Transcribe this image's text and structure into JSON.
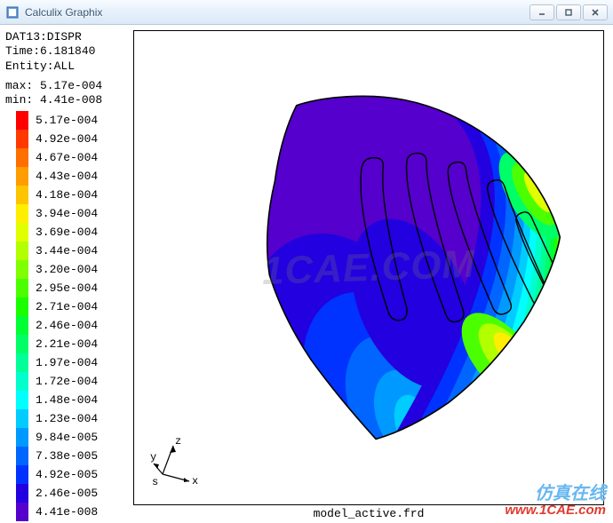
{
  "window": {
    "title": "Calculix Graphix"
  },
  "info": {
    "dataset": "DAT13:DISPR",
    "time_label": "Time:6.181840",
    "entity": "Entity:ALL"
  },
  "range": {
    "max_label": "max: 5.17e-004",
    "min_label": "min: 4.41e-008"
  },
  "legend": [
    {
      "value": "5.17e-004",
      "color": "#ff0000"
    },
    {
      "value": "4.92e-004",
      "color": "#ff3900"
    },
    {
      "value": "4.67e-004",
      "color": "#ff6e00"
    },
    {
      "value": "4.43e-004",
      "color": "#ff9c00"
    },
    {
      "value": "4.18e-004",
      "color": "#ffc400"
    },
    {
      "value": "3.94e-004",
      "color": "#ffee00"
    },
    {
      "value": "3.69e-004",
      "color": "#e2ff00"
    },
    {
      "value": "3.44e-004",
      "color": "#b2ff00"
    },
    {
      "value": "3.20e-004",
      "color": "#80ff00"
    },
    {
      "value": "2.95e-004",
      "color": "#4cff00"
    },
    {
      "value": "2.71e-004",
      "color": "#1aff00"
    },
    {
      "value": "2.46e-004",
      "color": "#00ff33"
    },
    {
      "value": "2.21e-004",
      "color": "#00ff66"
    },
    {
      "value": "1.97e-004",
      "color": "#00ff99"
    },
    {
      "value": "1.72e-004",
      "color": "#00ffcc"
    },
    {
      "value": "1.48e-004",
      "color": "#00ffff"
    },
    {
      "value": "1.23e-004",
      "color": "#00ccff"
    },
    {
      "value": "9.84e-005",
      "color": "#0099ff"
    },
    {
      "value": "7.38e-005",
      "color": "#0066ff"
    },
    {
      "value": "4.92e-005",
      "color": "#0033ff"
    },
    {
      "value": "2.46e-005",
      "color": "#2200e0"
    },
    {
      "value": "4.41e-008",
      "color": "#5500cc"
    }
  ],
  "axes": {
    "x": "x",
    "y": "y",
    "z": "z",
    "s": "s"
  },
  "viewport": {
    "filename": "model_active.frd"
  },
  "watermark": {
    "center": "1CAE.COM",
    "brand_cn": "仿真在线",
    "brand_url": "www.1CAE.com"
  }
}
